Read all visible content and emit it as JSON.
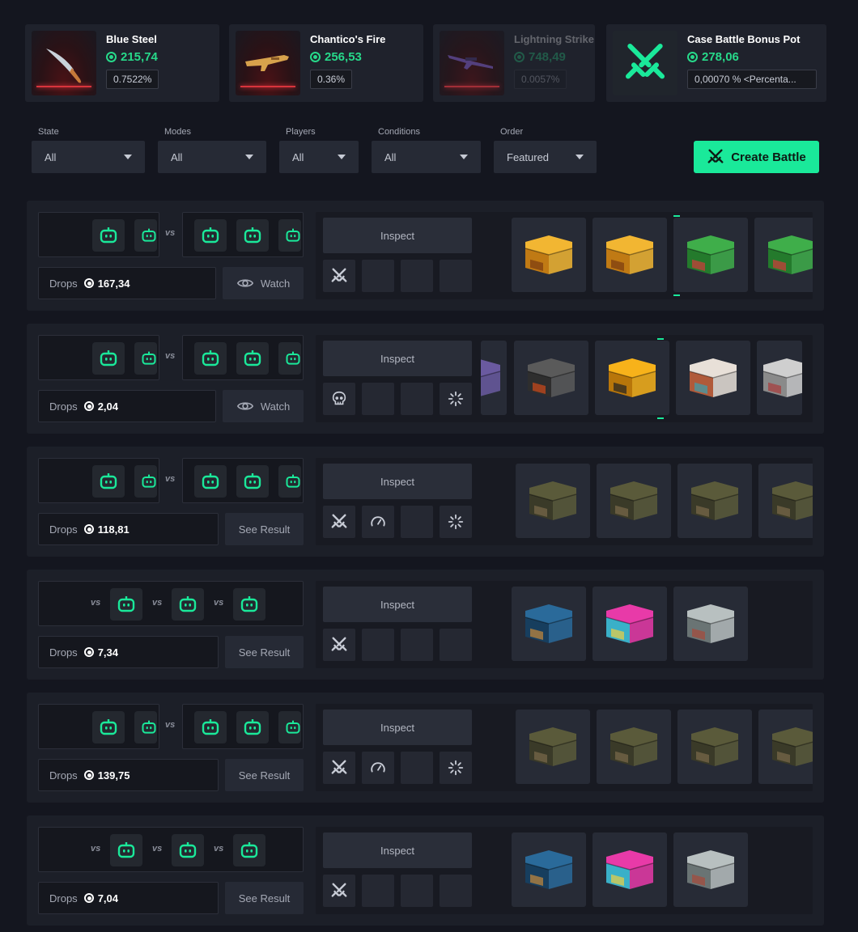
{
  "colors": {
    "accent": "#1ae99a",
    "price": "#27d98a",
    "background": "#14161f",
    "danger_line": "#d8343c"
  },
  "prizes": [
    {
      "name": "Blue Steel",
      "price": "215,74",
      "chance": "0.7522%",
      "icon": "knife-icon"
    },
    {
      "name": "Chantico's Fire",
      "price": "256,53",
      "chance": "0.36%",
      "icon": "rifle-icon"
    },
    {
      "name": "Lightning Strike",
      "price": "748,49",
      "chance": "0.0057%",
      "icon": "sniper-icon"
    },
    {
      "name": "Case Battle Bonus Pot",
      "price": "278,06",
      "chance": "0,00070 % <Percenta...",
      "icon": "crossed-swords-icon"
    }
  ],
  "filters": {
    "state": {
      "label": "State",
      "value": "All"
    },
    "modes": {
      "label": "Modes",
      "value": "All"
    },
    "players": {
      "label": "Players",
      "value": "All"
    },
    "conditions": {
      "label": "Conditions",
      "value": "All"
    },
    "order": {
      "label": "Order",
      "value": "Featured"
    }
  },
  "create_battle_label": "Create Battle",
  "vs_label": "vs",
  "drops_label": "Drops",
  "inspect_label": "Inspect",
  "battles": [
    {
      "drops": "167,34",
      "action": "Watch",
      "tags": [
        "crossed-swords-icon"
      ],
      "cases": [
        "gold-case",
        "gold-case",
        "green-case",
        "green-case"
      ]
    },
    {
      "drops": "2,04",
      "action": "Watch",
      "tags": [
        "skull-icon",
        "spinner-icon"
      ],
      "cases": [
        "purple-case",
        "mfo-case",
        "biohazard-case",
        "floral-case",
        "grey-case"
      ]
    },
    {
      "drops": "118,81",
      "action": "See Result",
      "tags": [
        "crossed-swords-icon",
        "speedometer-icon",
        "spinner-icon"
      ],
      "cases": [
        "camo-case",
        "camo-case",
        "camo-case",
        "camo-case"
      ]
    },
    {
      "drops": "7,34",
      "action": "See Result",
      "tags": [
        "crossed-swords-icon"
      ],
      "cases": [
        "blue-case",
        "pink-case",
        "silver-case"
      ]
    },
    {
      "drops": "139,75",
      "action": "See Result",
      "tags": [
        "crossed-swords-icon",
        "speedometer-icon",
        "spinner-icon"
      ],
      "cases": [
        "camo-case",
        "camo-case",
        "camo-case",
        "camo-case"
      ]
    },
    {
      "drops": "7,04",
      "action": "See Result",
      "tags": [
        "crossed-swords-icon"
      ],
      "cases": [
        "blue-case",
        "pink-case",
        "silver-case"
      ]
    }
  ]
}
